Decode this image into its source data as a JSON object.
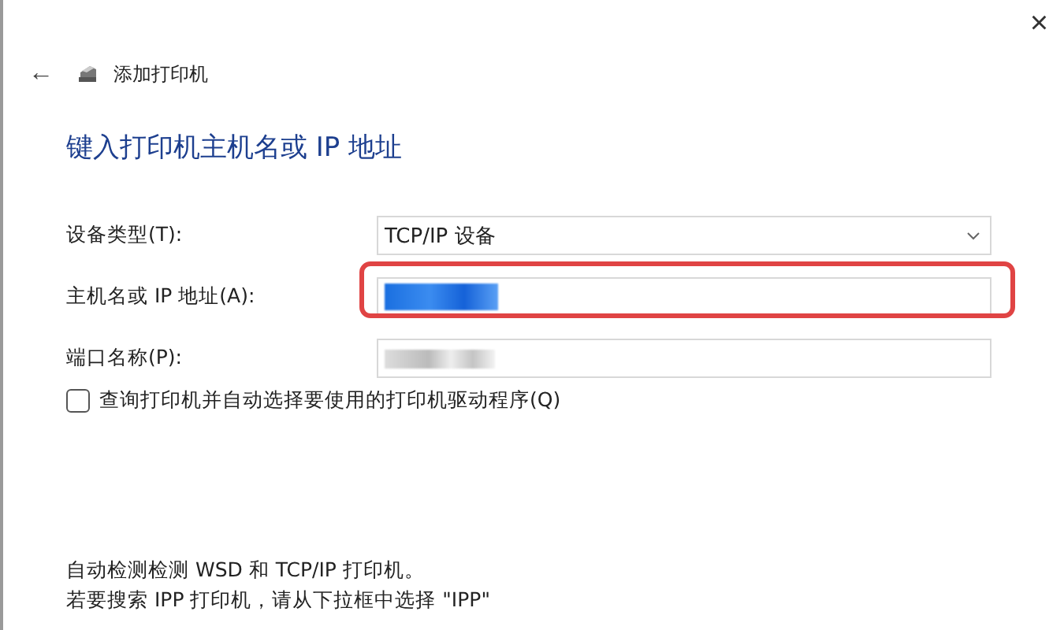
{
  "window": {
    "close": "×",
    "back": "←",
    "title": "添加打印机"
  },
  "heading": "键入打印机主机名或 IP 地址",
  "fields": [
    {
      "kind": "dropdown",
      "label": "设备类型(T):",
      "value": "TCP/IP 设备",
      "highlighted": false
    },
    {
      "kind": "blurred",
      "label": "主机名或 IP 地址(A):",
      "focused": true,
      "highlighted": true
    },
    {
      "kind": "blurred",
      "label": "端口名称(P):",
      "focused": false,
      "highlighted": false
    }
  ],
  "checkbox": {
    "label": "查询打印机并自动选择要使用的打印机驱动程序(Q)",
    "checked": false
  },
  "notes": [
    "自动检测检测 WSD 和 TCP/IP 打印机。",
    "若要搜索 IPP 打印机，请从下拉框中选择 \"IPP\""
  ]
}
